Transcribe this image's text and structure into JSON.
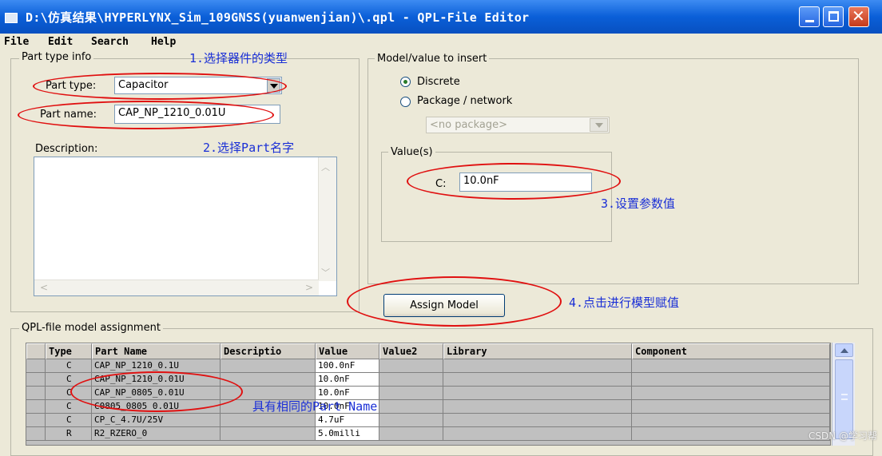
{
  "window": {
    "title": "D:\\仿真结果\\HYPERLYNX_Sim_109GNSS(yuanwenjian)\\.qpl - QPL-File Editor"
  },
  "menu": [
    "File",
    "Edit",
    "Search",
    "Help"
  ],
  "part_type_info": {
    "group_label": "Part type info",
    "part_type_label": "Part type:",
    "part_type_value": "Capacitor",
    "part_name_label": "Part name:",
    "part_name_value": "CAP_NP_1210_0.01U",
    "description_label": "Description:"
  },
  "model_value": {
    "group_label": "Model/value to insert",
    "radio_discrete": "Discrete",
    "radio_package": "Package / network",
    "selected": "Discrete",
    "package_placeholder": "<no package>",
    "values_group_label": "Value(s)",
    "c_label": "C:",
    "c_value": "10.0nF"
  },
  "assign_button": "Assign Model",
  "annotations": {
    "step1": "1.选择器件的类型",
    "step2": "2.选择Part名字",
    "step3": "3.设置参数值",
    "step4": "4.点击进行模型赋值",
    "same_name": "具有相同的Part Name"
  },
  "qpl_table": {
    "group_label": "QPL-file model assignment",
    "columns": [
      "Type",
      "Part Name",
      "Descriptio",
      "Value",
      "Value2",
      "Library",
      "Component"
    ],
    "rows": [
      [
        "C",
        "CAP_NP_1210_0.1U",
        "",
        "100.0nF",
        "",
        "",
        ""
      ],
      [
        "C",
        "CAP_NP_1210_0.01U",
        "",
        "10.0nF",
        "",
        "",
        ""
      ],
      [
        "C",
        "CAP_NP_0805_0.01U",
        "",
        "10.0nF",
        "",
        "",
        ""
      ],
      [
        "C",
        "C0805_0805_0.01U",
        "",
        "10.0nF",
        "",
        "",
        ""
      ],
      [
        "C",
        "CP_C_4.7U/25V",
        "",
        "4.7uF",
        "",
        "",
        ""
      ],
      [
        "R",
        "R2_RZERO_0",
        "",
        "5.0milli",
        "",
        "",
        ""
      ]
    ]
  },
  "watermark": "CSDN @学习帮"
}
